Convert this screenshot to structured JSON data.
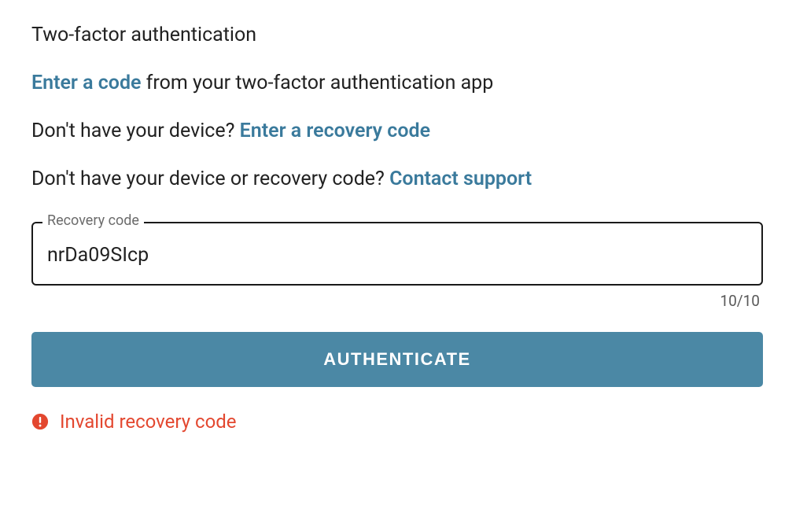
{
  "title": "Two-factor authentication",
  "line1": {
    "link": "Enter a code",
    "text": " from your two-factor authentication app"
  },
  "line2": {
    "text": "Don't have your device? ",
    "link": "Enter a recovery code"
  },
  "line3": {
    "text": "Don't have your device or recovery code? ",
    "link": "Contact support"
  },
  "input": {
    "label": "Recovery code",
    "value": "nrDa09SIcp"
  },
  "counter": "10/10",
  "button": "AUTHENTICATE",
  "error": {
    "message": "Invalid recovery code"
  },
  "colors": {
    "link": "#3a7a9c",
    "button_bg": "#4b88a5",
    "error": "#e3472f"
  }
}
